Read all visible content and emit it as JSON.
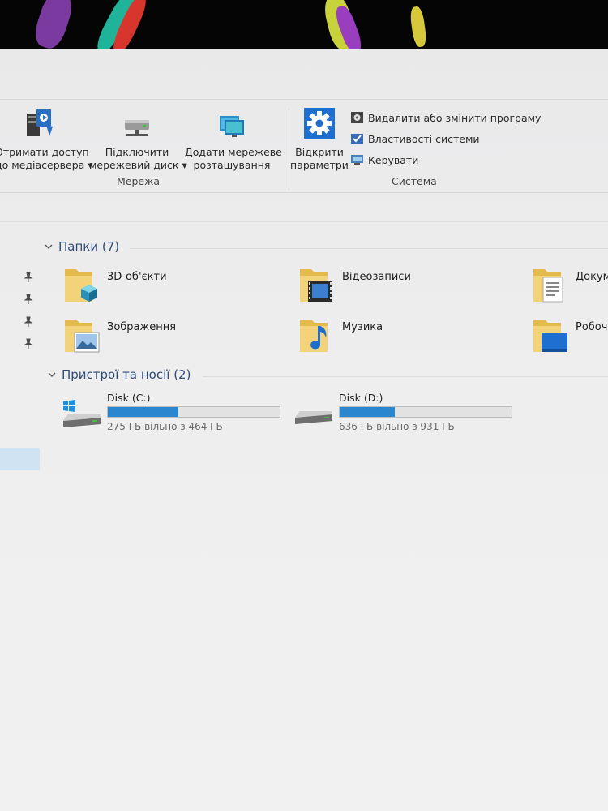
{
  "ribbon": {
    "buttons": [
      {
        "label1": "Отримати доступ",
        "label2": "до медіасервера ▾"
      },
      {
        "label1": "Підключити",
        "label2": "мережевий диск ▾"
      },
      {
        "label1": "Додати мережеве",
        "label2": "розташування"
      },
      {
        "label1": "Відкрити",
        "label2": "параметри"
      }
    ],
    "system_items": [
      {
        "label": "Видалити або змінити програму",
        "icon": "uninstall-icon"
      },
      {
        "label": "Властивості системи",
        "icon": "system-properties-icon"
      },
      {
        "label": "Керувати",
        "icon": "manage-icon"
      }
    ],
    "groups": {
      "network": "Мережа",
      "system": "Система"
    }
  },
  "folders_section": {
    "title": "Папки (7)",
    "items": [
      {
        "label": "3D-об'єкти",
        "icon": "3d-objects-folder-icon"
      },
      {
        "label": "Відеозаписи",
        "icon": "videos-folder-icon"
      },
      {
        "label": "Докум",
        "icon": "documents-folder-icon"
      },
      {
        "label": "Зображення",
        "icon": "pictures-folder-icon"
      },
      {
        "label": "Музика",
        "icon": "music-folder-icon"
      },
      {
        "label": "Робочи",
        "icon": "desktop-folder-icon"
      }
    ]
  },
  "devices_section": {
    "title": "Пристрої та носії (2)",
    "drives": [
      {
        "name": "Disk (C:)",
        "free_text": "275 ГБ вільно з 464 ГБ",
        "used_fraction": 0.41
      },
      {
        "name": "Disk (D:)",
        "free_text": "636 ГБ вільно з 931 ГБ",
        "used_fraction": 0.32
      }
    ]
  },
  "colors": {
    "accent": "#2b86d0",
    "section_title": "#2f4d7a",
    "folder": "#e8c25b"
  }
}
